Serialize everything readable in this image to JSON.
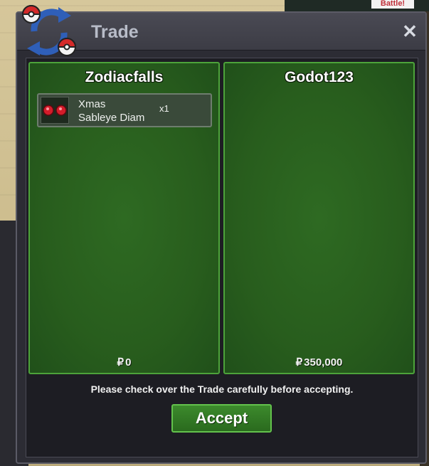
{
  "background": {
    "badge_label": "Battle!"
  },
  "window": {
    "title": "Trade",
    "close_label": "✕"
  },
  "left_panel": {
    "player_name": "Zodiacfalls",
    "items": [
      {
        "name_line1": "Xmas",
        "name_line2": "Sableye Diam",
        "quantity": "x1",
        "icon": "red-gems-icon"
      }
    ],
    "currency_symbol": "₽",
    "money": "0"
  },
  "right_panel": {
    "player_name": "Godot123",
    "items": [],
    "currency_symbol": "₽",
    "money": "350,000"
  },
  "footer": {
    "notice": "Please check over the Trade carefully before accepting.",
    "accept_label": "Accept"
  },
  "colors": {
    "panel_green": "#285d1d",
    "panel_border": "#4da33a",
    "window_bg": "#2c2c34",
    "accept_green": "#3c8a2c"
  }
}
